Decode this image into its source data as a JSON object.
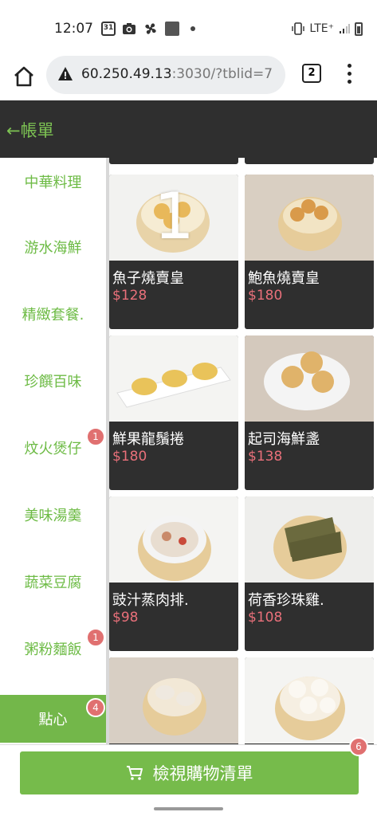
{
  "status_bar": {
    "time": "12:07",
    "calendar_day": "31",
    "network": "LTE⁺"
  },
  "browser": {
    "url_host": "60.250.49.13",
    "url_rest": ":3030/?tblid=7",
    "tab_count": "2"
  },
  "header": {
    "back_label": "←帳單"
  },
  "sidebar": {
    "items": [
      {
        "label": "中華料理",
        "badge": ""
      },
      {
        "label": "游水海鮮",
        "badge": ""
      },
      {
        "label": "精緻套餐.",
        "badge": ""
      },
      {
        "label": "珍饌百味",
        "badge": ""
      },
      {
        "label": "炆火煲仔",
        "badge": "1"
      },
      {
        "label": "美味湯羹",
        "badge": ""
      },
      {
        "label": "蔬菜豆腐",
        "badge": ""
      },
      {
        "label": "粥粉麵飯",
        "badge": "1"
      },
      {
        "label": "點心",
        "badge": "4"
      }
    ],
    "active_index": 8
  },
  "products": [
    {
      "name": "魚子燒賣皇",
      "price": "$128",
      "qty": "1"
    },
    {
      "name": "鮑魚燒賣皇",
      "price": "$180",
      "qty": ""
    },
    {
      "name": "鮮果龍鬚捲",
      "price": "$180",
      "qty": ""
    },
    {
      "name": "起司海鮮盞",
      "price": "$138",
      "qty": ""
    },
    {
      "name": "豉汁蒸肉排.",
      "price": "$98",
      "qty": ""
    },
    {
      "name": "荷香珍珠雞.",
      "price": "$108",
      "qty": ""
    },
    {
      "name": "",
      "price": "",
      "qty": ""
    },
    {
      "name": "",
      "price": "",
      "qty": ""
    }
  ],
  "cart": {
    "label": "檢視購物清單",
    "count": "6"
  },
  "colors": {
    "accent": "#76bb4b",
    "header_bg": "#2f2f2f",
    "price": "#e9707a",
    "badge": "#e07070"
  }
}
